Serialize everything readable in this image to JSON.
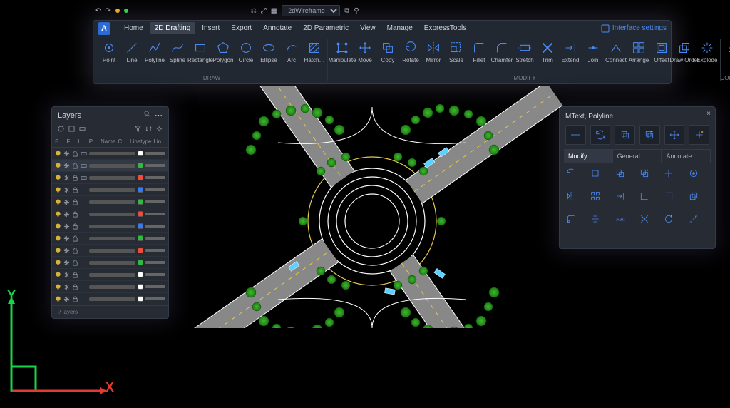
{
  "qat_dropdown": "2dWireframe",
  "menu": {
    "items": [
      "Home",
      "2D Drafting",
      "Insert",
      "Export",
      "Annotate",
      "2D Parametric",
      "View",
      "Manage",
      "ExpressTools"
    ],
    "active_index": 1,
    "interface_settings": "Interface settings"
  },
  "toolbar": {
    "draw": {
      "label": "DRAW",
      "items": [
        {
          "label": "Point",
          "icon": "point"
        },
        {
          "label": "Line",
          "icon": "line"
        },
        {
          "label": "Polyline",
          "icon": "polyline"
        },
        {
          "label": "Spline",
          "icon": "spline"
        },
        {
          "label": "Rectangle",
          "icon": "rect"
        },
        {
          "label": "Polygon",
          "icon": "polygon"
        },
        {
          "label": "Circle",
          "icon": "circle"
        },
        {
          "label": "Ellipse",
          "icon": "ellipse"
        },
        {
          "label": "Arc",
          "icon": "arc"
        },
        {
          "label": "Hatch…",
          "icon": "hatch"
        }
      ]
    },
    "modify": {
      "label": "MODIFY",
      "items": [
        {
          "label": "Manipulate",
          "icon": "manipulate"
        },
        {
          "label": "Move",
          "icon": "move"
        },
        {
          "label": "Copy",
          "icon": "copy"
        },
        {
          "label": "Rotate",
          "icon": "rotate"
        },
        {
          "label": "Mirror",
          "icon": "mirror"
        },
        {
          "label": "Scale",
          "icon": "scale"
        },
        {
          "label": "Fillet",
          "icon": "fillet"
        },
        {
          "label": "Chamfer",
          "icon": "chamfer"
        },
        {
          "label": "Stretch",
          "icon": "stretch"
        },
        {
          "label": "Trim",
          "icon": "trim"
        },
        {
          "label": "Extend",
          "icon": "extend"
        },
        {
          "label": "Join",
          "icon": "join"
        },
        {
          "label": "Connect",
          "icon": "connect"
        },
        {
          "label": "Arrange",
          "icon": "arrange"
        },
        {
          "label": "Offset",
          "icon": "offset"
        },
        {
          "label": "Draw Order",
          "icon": "draworder"
        },
        {
          "label": "Explode",
          "icon": "explode"
        }
      ]
    },
    "control": {
      "label": "CONTROL"
    }
  },
  "layers_panel": {
    "title": "Layers",
    "columns": [
      "S…",
      "F…",
      "L…",
      "P…",
      "Name",
      "C…",
      "Linetype",
      "Lin…"
    ],
    "footer": "? layers",
    "rows": [
      {
        "color": "#ffffff",
        "sel": false
      },
      {
        "color": "#2dbb41",
        "sel": true
      },
      {
        "color": "#f24b3a",
        "sel": false
      },
      {
        "color": "#3a7bf2",
        "sel": false
      },
      {
        "color": "#2dbb41",
        "sel": false
      },
      {
        "color": "#f24b3a",
        "sel": false
      },
      {
        "color": "#3a7bf2",
        "sel": false
      },
      {
        "color": "#2dbb41",
        "sel": false
      },
      {
        "color": "#f24b3a",
        "sel": false
      },
      {
        "color": "#2dbb41",
        "sel": false
      },
      {
        "color": "#ffffff",
        "sel": false
      },
      {
        "color": "#ffffff",
        "sel": false
      },
      {
        "color": "#ffffff",
        "sel": false
      }
    ]
  },
  "prop_panel": {
    "title": "MText, Polyline",
    "tabs": [
      "Modify",
      "General",
      "Annotate"
    ],
    "active_tab": 0,
    "abc_label": "ABC"
  },
  "ucs": {
    "y": "Y",
    "x": "X"
  }
}
